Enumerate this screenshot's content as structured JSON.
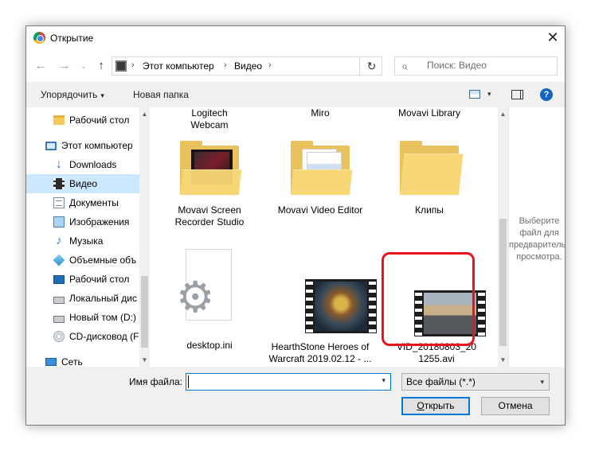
{
  "window": {
    "title": "Открытие",
    "close_glyph": "✕"
  },
  "navigation": {
    "back_glyph": "←",
    "forward_glyph": "→",
    "recent_glyph": "⌄",
    "up_glyph": "↑",
    "breadcrumbs": [
      "Этот компьютер",
      "Видео"
    ],
    "separator": "›",
    "refresh_glyph": "↻",
    "search_placeholder": "Поиск: Видео",
    "search_value": ""
  },
  "toolbar": {
    "organize_label": "Упорядочить",
    "new_folder_label": "Новая папка",
    "help_glyph": "?"
  },
  "sidebar": {
    "items": [
      {
        "label": "Рабочий стол",
        "icon": "folder-icon"
      },
      {
        "label": "Этот компьютер",
        "icon": "computer-icon"
      },
      {
        "label": "Downloads",
        "icon": "download-icon"
      },
      {
        "label": "Видео",
        "icon": "video-icon",
        "selected": true
      },
      {
        "label": "Документы",
        "icon": "documents-icon"
      },
      {
        "label": "Изображения",
        "icon": "pictures-icon"
      },
      {
        "label": "Музыка",
        "icon": "music-icon"
      },
      {
        "label": "Объемные объ",
        "icon": "3d-objects-icon"
      },
      {
        "label": "Рабочий стол",
        "icon": "desktop-icon"
      },
      {
        "label": "Локальный дис",
        "icon": "drive-icon"
      },
      {
        "label": "Новый том (D:)",
        "icon": "drive-icon"
      },
      {
        "label": "CD-дисковод (F:",
        "icon": "cd-drive-icon"
      },
      {
        "label": "Сеть",
        "icon": "network-icon"
      }
    ],
    "music_glyph": "♪",
    "download_glyph": "↓"
  },
  "files": {
    "top_row": [
      "Logitech Webcam",
      "Miro",
      "Movavi Library"
    ],
    "items": [
      {
        "name": "Movavi Screen Recorder Studio",
        "type": "folder"
      },
      {
        "name": "Movavi Video Editor",
        "type": "folder"
      },
      {
        "name": "Клипы",
        "type": "folder"
      },
      {
        "name": "desktop.ini",
        "type": "settings-file"
      },
      {
        "name": "HearthStone Heroes of Warcraft 2019.02.12 - ...",
        "type": "video"
      },
      {
        "name": "VID_20180803_201255.avi",
        "type": "video",
        "highlighted": true
      }
    ],
    "gear_glyph": "⚙"
  },
  "preview": {
    "message": "Выберите файл для предварительного просмотра."
  },
  "bottom": {
    "filename_label": "Имя файла:",
    "filename_value": "",
    "filter_value": "Все файлы (*.*)",
    "open_label_accel": "О",
    "open_label_rest": "ткрыть",
    "cancel_label": "Отмена",
    "caret_glyph": "▾"
  },
  "colors": {
    "accent": "#0078d7",
    "selection": "#cce8ff",
    "highlight_box": "#e8141c",
    "folder": "#f8d776"
  }
}
